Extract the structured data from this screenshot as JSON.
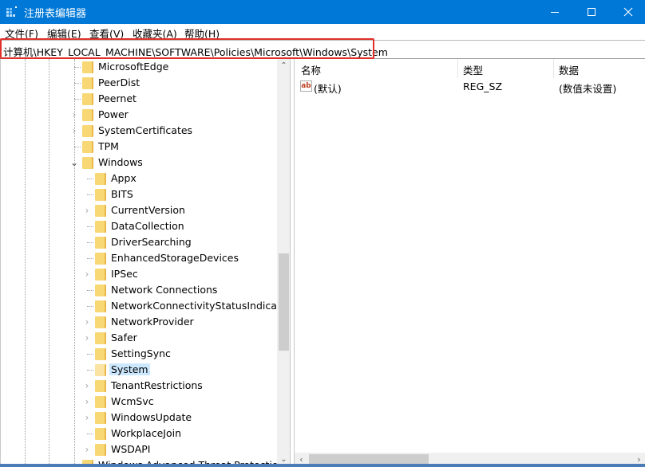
{
  "window": {
    "title": "注册表编辑器",
    "icons": {
      "app": "registry-editor-icon",
      "minimize": "minimize-icon",
      "maximize": "maximize-icon",
      "close": "close-icon"
    }
  },
  "menu": [
    "文件(F)",
    "编辑(E)",
    "查看(V)",
    "收藏夹(A)",
    "帮助(H)"
  ],
  "address": {
    "path": "计算机\\HKEY_LOCAL_MACHINE\\SOFTWARE\\Policies\\Microsoft\\Windows\\System",
    "highlight_color": "#e0302a"
  },
  "tree": {
    "items": [
      {
        "label": "MicrosoftEdge",
        "level": 1,
        "expander": "none"
      },
      {
        "label": "PeerDist",
        "level": 1,
        "expander": "none"
      },
      {
        "label": "Peernet",
        "level": 1,
        "expander": "none"
      },
      {
        "label": "Power",
        "level": 1,
        "expander": "collapsed"
      },
      {
        "label": "SystemCertificates",
        "level": 1,
        "expander": "collapsed"
      },
      {
        "label": "TPM",
        "level": 1,
        "expander": "none"
      },
      {
        "label": "Windows",
        "level": 1,
        "expander": "expanded"
      },
      {
        "label": "Appx",
        "level": 2,
        "expander": "none"
      },
      {
        "label": "BITS",
        "level": 2,
        "expander": "none"
      },
      {
        "label": "CurrentVersion",
        "level": 2,
        "expander": "collapsed"
      },
      {
        "label": "DataCollection",
        "level": 2,
        "expander": "none"
      },
      {
        "label": "DriverSearching",
        "level": 2,
        "expander": "none"
      },
      {
        "label": "EnhancedStorageDevices",
        "level": 2,
        "expander": "none"
      },
      {
        "label": "IPSec",
        "level": 2,
        "expander": "collapsed"
      },
      {
        "label": "Network Connections",
        "level": 2,
        "expander": "none"
      },
      {
        "label": "NetworkConnectivityStatusIndicator",
        "level": 2,
        "expander": "none"
      },
      {
        "label": "NetworkProvider",
        "level": 2,
        "expander": "collapsed"
      },
      {
        "label": "Safer",
        "level": 2,
        "expander": "collapsed"
      },
      {
        "label": "SettingSync",
        "level": 2,
        "expander": "none"
      },
      {
        "label": "System",
        "level": 2,
        "expander": "none",
        "selected": true
      },
      {
        "label": "TenantRestrictions",
        "level": 2,
        "expander": "collapsed"
      },
      {
        "label": "WcmSvc",
        "level": 2,
        "expander": "collapsed"
      },
      {
        "label": "WindowsUpdate",
        "level": 2,
        "expander": "collapsed"
      },
      {
        "label": "WorkplaceJoin",
        "level": 2,
        "expander": "none"
      },
      {
        "label": "WSDAPI",
        "level": 2,
        "expander": "collapsed"
      },
      {
        "label": "Windows Advanced Threat Protection",
        "level": 1,
        "expander": "none"
      }
    ],
    "selection_color": "#cce8ff",
    "scroll_position_fraction": 0.55
  },
  "list": {
    "columns": [
      "名称",
      "类型",
      "数据"
    ],
    "rows": [
      {
        "name": "(默认)",
        "type": "REG_SZ",
        "data": "(数值未设置)",
        "icon": "string-value-icon"
      }
    ]
  },
  "colors": {
    "titlebar": "#0078d7",
    "folder": "#f8d775"
  }
}
